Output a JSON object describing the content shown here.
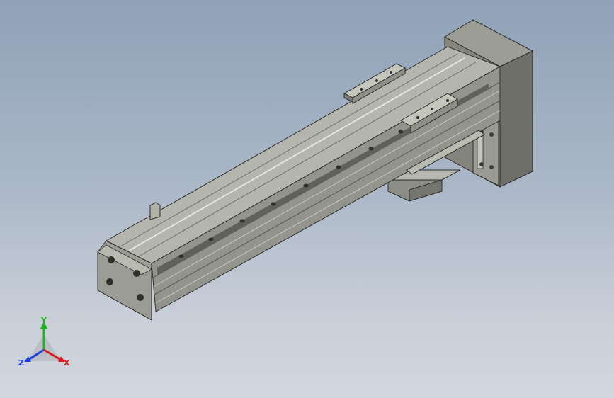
{
  "viewport": {
    "background_top": "#8fa2b8",
    "background_bottom": "#d2d6de"
  },
  "model": {
    "part_name": "linear-actuator-module",
    "body_color": "#a3a69c",
    "shadow_color": "#6e7068",
    "motor_color": "#77776f"
  },
  "triad": {
    "x_label": "X",
    "y_label": "Y",
    "z_label": "Z",
    "x_color": "#d81b1b",
    "y_color": "#1fb31f",
    "z_color": "#1b3fd8"
  }
}
